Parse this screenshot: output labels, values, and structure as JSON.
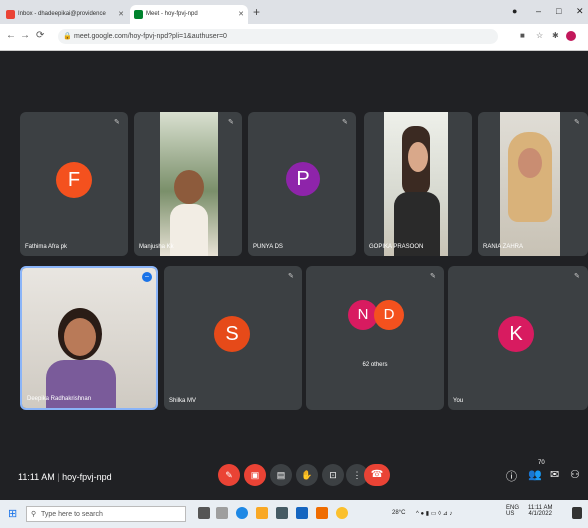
{
  "browser": {
    "tabs": [
      {
        "label": "Inbox - dhadeepikai@providence",
        "favicon": "gmail-icon"
      },
      {
        "label": "Meet - hoy-fpvj-npd",
        "favicon": "meet-icon"
      }
    ],
    "url": "meet.google.com/hoy-fpvj-npd?pli=1&authuser=0"
  },
  "participants": [
    {
      "name": "Fathima Afra pk",
      "initial": "F",
      "color": "#f4511e",
      "video": false
    },
    {
      "name": "Manjusha Kk",
      "video": true
    },
    {
      "name": "PUNYA DS",
      "initial": "P",
      "color": "#8e24aa",
      "video": false
    },
    {
      "name": "GOPIKA PRASOON",
      "video": true
    },
    {
      "name": "RANIA ZAHRA",
      "video": true
    },
    {
      "name": "Deepika Radhakrishnan",
      "video": true
    },
    {
      "name": "Shilka MV",
      "initial": "S",
      "color": "#e64a19",
      "video": false
    },
    {
      "name": "62 others",
      "initials": [
        "N",
        "D"
      ],
      "colors": [
        "#d81b60",
        "#f4511e"
      ],
      "video": false
    },
    {
      "name": "You",
      "initial": "K",
      "color": "#d81b60",
      "video": false
    }
  ],
  "controls": {
    "time": "11:11 AM",
    "meeting_code": "hoy-fpvj-npd",
    "participant_count": "70"
  },
  "taskbar": {
    "search_placeholder": "Type here to search",
    "weather": "28°C",
    "lang": "ENG",
    "region": "US",
    "clock": "11:11 AM",
    "date": "4/1/2022"
  },
  "colors": {
    "meet_bg": "#202124",
    "tile_bg": "#3c4043",
    "end_call": "#ea4335"
  }
}
